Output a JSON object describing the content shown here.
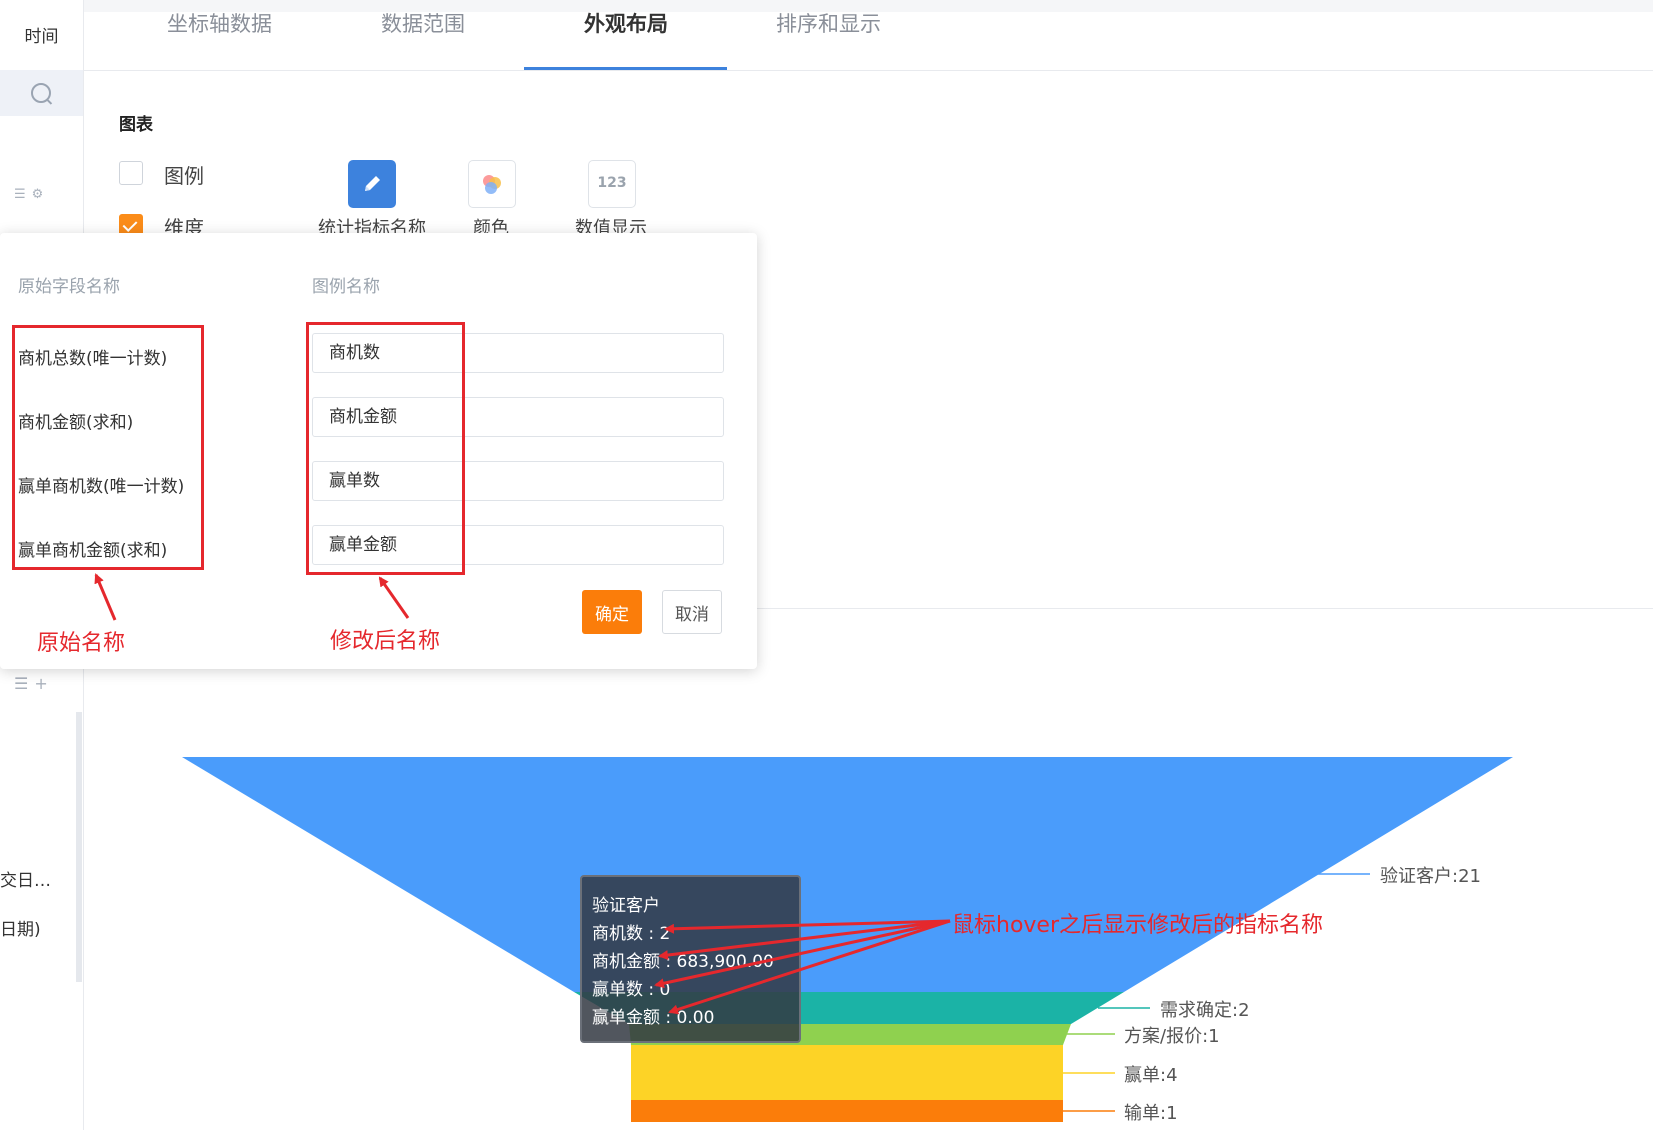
{
  "sidebar": {
    "time_label": "时间",
    "item_text_1": "交日…",
    "item_text_2": "日期)"
  },
  "tabs": [
    {
      "label": "坐标轴数据",
      "active": false
    },
    {
      "label": "数据范围",
      "active": false
    },
    {
      "label": "外观布局",
      "active": true
    },
    {
      "label": "排序和显示",
      "active": false
    }
  ],
  "chart_settings": {
    "section_title": "图表",
    "legend_checkbox": {
      "label": "图例",
      "checked": false
    },
    "dimension_checkbox": {
      "label": "维度",
      "checked": true
    },
    "options": [
      {
        "label": "统计指标名称",
        "icon": "pencil-icon",
        "selected": true
      },
      {
        "label": "颜色",
        "icon": "color-circles-icon",
        "selected": false
      },
      {
        "label": "数值显示",
        "icon": "number-123-icon",
        "selected": false
      }
    ],
    "number_icon_text": "123"
  },
  "rename_popup": {
    "col_original": "原始字段名称",
    "col_legend": "图例名称",
    "rows": [
      {
        "original": "商机总数(唯一计数)",
        "legend": "商机数"
      },
      {
        "original": "商机金额(求和)",
        "legend": "商机金额"
      },
      {
        "original": "赢单商机数(唯一计数)",
        "legend": "赢单数"
      },
      {
        "original": "赢单商机金额(求和)",
        "legend": "赢单金额"
      }
    ],
    "confirm_label": "确定",
    "cancel_label": "取消"
  },
  "annotations": {
    "original_name": "原始名称",
    "modified_name": "修改后名称",
    "hover_note": "鼠标hover之后显示修改后的指标名称"
  },
  "funnel": {
    "stages": [
      {
        "name": "验证客户",
        "value": 21,
        "label": "验证客户:21",
        "color": "#4a9cfb"
      },
      {
        "name": "需求确定",
        "value": 2,
        "label": "需求确定:2",
        "color": "#1bb3a6"
      },
      {
        "name": "方案/报价",
        "value": 1,
        "label": "方案/报价:1",
        "color": "#8fd14f"
      },
      {
        "name": "赢单",
        "value": 4,
        "label": "赢单:4",
        "color": "#fdd326"
      },
      {
        "name": "输单",
        "value": 1,
        "label": "输单:1",
        "color": "#fb7d0a"
      }
    ],
    "tooltip": {
      "title": "验证客户",
      "lines": [
        "商机数 : 2",
        "商机金额 : 683,900.00",
        "赢单数 : 0",
        "赢单金额 : 0.00"
      ]
    }
  },
  "colors": {
    "accent_orange": "#fb7d0a",
    "accent_blue": "#3d82dd",
    "annotation_red": "#e5282d"
  }
}
